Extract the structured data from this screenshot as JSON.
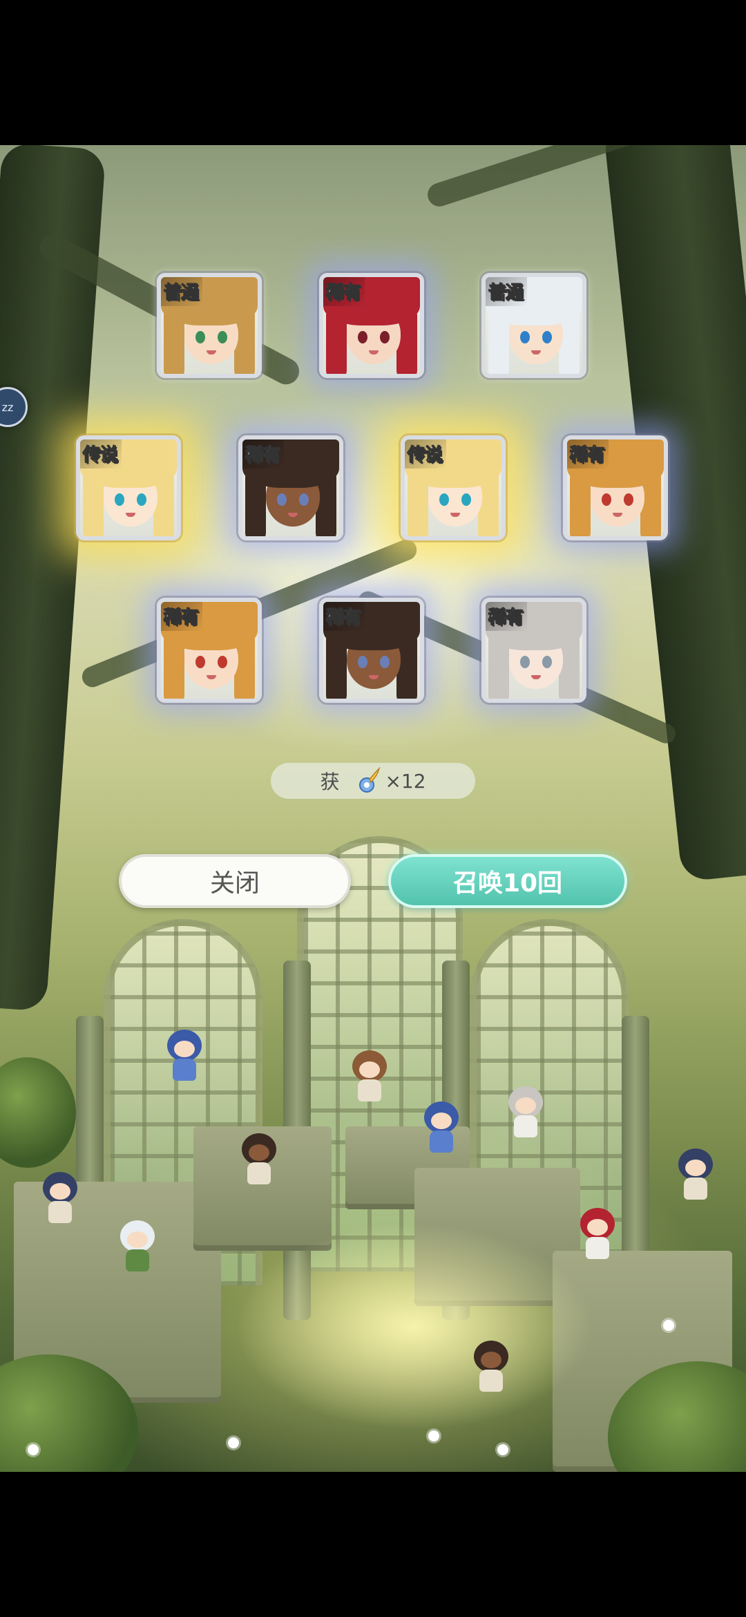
{
  "colors": {
    "card_glow_rare": "#96a0ff",
    "card_glow_legendary": "#ffe15a",
    "summon_button": "#52c3ad",
    "close_button": "#fbfbf7"
  },
  "side_badge": {
    "label": "zz"
  },
  "cards": [
    {
      "rarity": "普通",
      "kind": "common",
      "hair": "#c99a4e",
      "skin": "#f7dcc3",
      "eyes": "#3b8e58"
    },
    {
      "rarity": "稀有",
      "kind": "rare",
      "hair": "#b32330",
      "skin": "#f5d7c2",
      "eyes": "#7b1f2a"
    },
    {
      "rarity": "普通",
      "kind": "common",
      "hair": "#e9eef2",
      "skin": "#f8e1cc",
      "eyes": "#2f80c8"
    },
    {
      "rarity": "传说",
      "kind": "legendary",
      "hair": "#f2d98a",
      "skin": "#fbe6d2",
      "eyes": "#2aa6c0"
    },
    {
      "rarity": "稀有",
      "kind": "rare",
      "hair": "#3a2a22",
      "skin": "#8a5a3a",
      "eyes": "#6a7fb8"
    },
    {
      "rarity": "传说",
      "kind": "legendary",
      "hair": "#f2d98a",
      "skin": "#fbe6d2",
      "eyes": "#2aa6c0"
    },
    {
      "rarity": "稀有",
      "kind": "rare",
      "hair": "#d99a42",
      "skin": "#f8dcc6",
      "eyes": "#c03a30"
    },
    {
      "rarity": "稀有",
      "kind": "rare",
      "hair": "#d99a42",
      "skin": "#f8dcc6",
      "eyes": "#c03a30"
    },
    {
      "rarity": "稀有",
      "kind": "rare",
      "hair": "#3a2a22",
      "skin": "#8a5a3a",
      "eyes": "#6a7fb8"
    },
    {
      "rarity": "稀有",
      "kind": "rare",
      "hair": "#c9c6c2",
      "skin": "#f8e6da",
      "eyes": "#8a9aa6"
    }
  ],
  "reward": {
    "label": "获",
    "icon": "feather-icon",
    "amount": "×12"
  },
  "buttons": {
    "close": "关闭",
    "summon": "召唤10回"
  }
}
